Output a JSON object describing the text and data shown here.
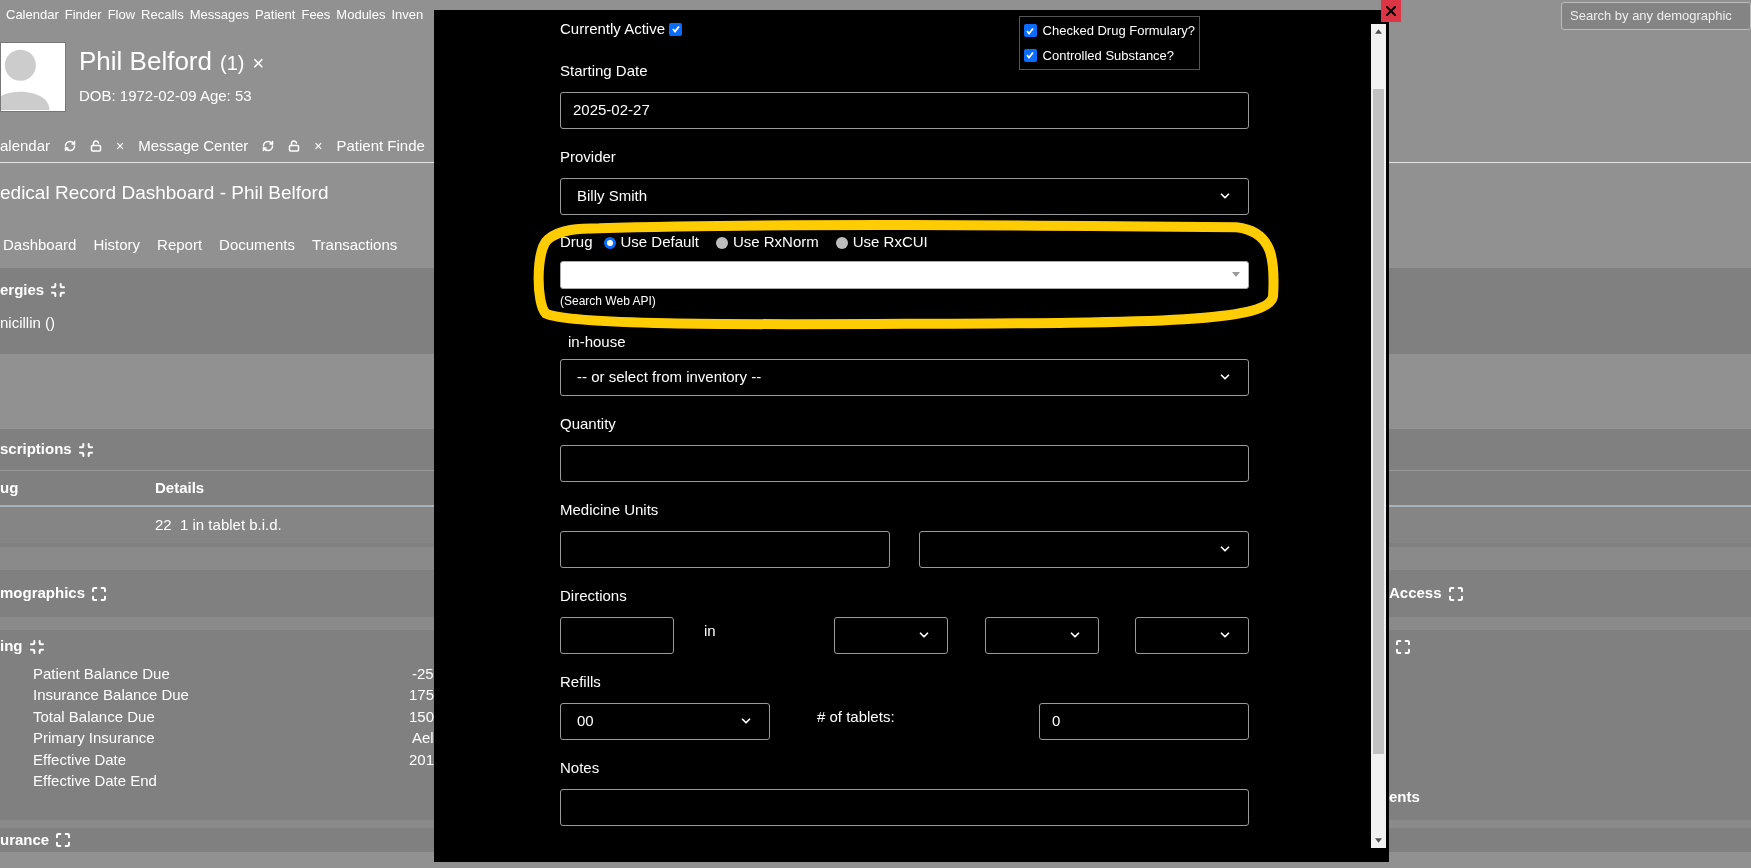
{
  "nav": {
    "items": [
      "Calendar",
      "Finder",
      "Flow",
      "Recalls",
      "Messages",
      "Patient",
      "Fees",
      "Modules",
      "Inven"
    ],
    "search": {
      "placeholder": "Search by any demographic"
    }
  },
  "patient": {
    "name": "Phil Belford",
    "count": "(1)",
    "close": "×",
    "dob": "DOB: 1972-02-09 Age: 53"
  },
  "open_tabs": [
    {
      "label": "alendar",
      "close": "×",
      "tools": true
    },
    {
      "label": "Message Center",
      "close": "×",
      "tools": true
    },
    {
      "label": "Patient Finde",
      "tools": false
    }
  ],
  "dashboard": {
    "title": "edical Record Dashboard - Phil Belford",
    "tabs": [
      "Dashboard",
      "History",
      "Report",
      "Documents",
      "Transactions"
    ]
  },
  "allergies": {
    "title": "ergies",
    "expanded": true,
    "items": [
      "nicillin ()"
    ]
  },
  "prescriptions": {
    "title": "scriptions",
    "expanded": true,
    "columns": [
      "ug",
      "Details"
    ],
    "rows": [
      [
        "",
        "22  1 in tablet b.i.d."
      ]
    ]
  },
  "demographics": {
    "title": "mographics",
    "expanded": false,
    "right_title": "Access",
    "right_expanded": false
  },
  "billing": {
    "title": "ing",
    "expanded": true,
    "right_expanded": false,
    "right_footer": "ents",
    "rows": [
      {
        "label": "Patient Balance Due",
        "value": "-25"
      },
      {
        "label": "Insurance Balance Due",
        "value": "175"
      },
      {
        "label": "Total Balance Due",
        "value": "150"
      },
      {
        "label": "Primary Insurance",
        "value": "Ael"
      },
      {
        "label": "Effective Date",
        "value": "201"
      },
      {
        "label": "Effective Date End",
        "value": ""
      }
    ]
  },
  "insurance": {
    "title": "urance",
    "expanded": false
  },
  "modal": {
    "currently_active": {
      "label": "Currently Active",
      "checked": true
    },
    "checks": [
      {
        "label": "Checked Drug Formulary?",
        "checked": true
      },
      {
        "label": "Controlled Substance?",
        "checked": true
      }
    ],
    "starting_date": {
      "label": "Starting Date",
      "value": "2025-02-27"
    },
    "provider": {
      "label": "Provider",
      "value": "Billy Smith"
    },
    "drug": {
      "label": "Drug",
      "options": [
        {
          "label": "Use Default",
          "selected": true
        },
        {
          "label": "Use RxNorm",
          "selected": false
        },
        {
          "label": "Use RxCUI",
          "selected": false
        }
      ],
      "hint": "(Search Web API)"
    },
    "in_house": {
      "label": "in-house",
      "value": "-- or select from inventory --"
    },
    "quantity": {
      "label": "Quantity"
    },
    "medicine_units": {
      "label": "Medicine Units"
    },
    "directions": {
      "label": "Directions",
      "joiner": "in"
    },
    "refills": {
      "label": "Refills",
      "value": "00"
    },
    "tablets": {
      "label": "# of tablets:",
      "value": "0"
    },
    "notes": {
      "label": "Notes"
    }
  }
}
